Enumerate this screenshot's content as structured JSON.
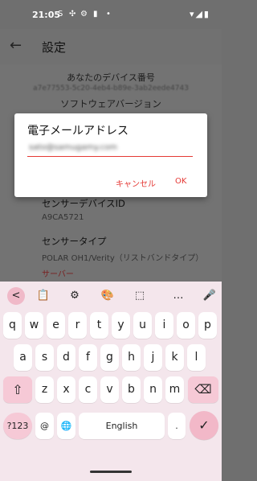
{
  "status": {
    "time": "21:05",
    "icons": [
      "S",
      "✣",
      "⚙",
      "▮",
      "•"
    ],
    "right": "▾◢▮"
  },
  "appbar": {
    "back_glyph": "←",
    "title": "設定"
  },
  "settings": {
    "device_number_label": "あなたのデバイス番号",
    "device_number_value": "a7e77553-5c20-4eb4-b89e-3ab2eede4743",
    "software_version_label": "ソフトウェアバージョン",
    "sensor_device_id_label": "センサーデバイスID",
    "sensor_device_id_value": "A9CA5721",
    "sensor_type_label": "センサータイプ",
    "sensor_type_value": "POLAR OH1/Verity（リストバンドタイプ）",
    "section_next": "サーバー"
  },
  "dialog": {
    "title": "電子メールアドレス",
    "input_value": "sato@samugamy.com",
    "cancel_label": "キャンセル",
    "ok_label": "OK",
    "accent_color": "#e53935"
  },
  "keyboard": {
    "toolbar": [
      "<",
      "📋",
      "⚙",
      "🎨",
      "⬚",
      "…",
      "🎤"
    ],
    "row1": [
      "q",
      "w",
      "e",
      "r",
      "t",
      "y",
      "u",
      "i",
      "o",
      "p"
    ],
    "row2": [
      "a",
      "s",
      "d",
      "f",
      "g",
      "h",
      "j",
      "k",
      "l"
    ],
    "row3": [
      "z",
      "x",
      "c",
      "v",
      "b",
      "n",
      "m"
    ],
    "shift": "⇧",
    "backspace": "⌫",
    "symbols": "?123",
    "at": "@",
    "globe": "🌐",
    "space": "English",
    "period": ".",
    "enter": "✓"
  }
}
